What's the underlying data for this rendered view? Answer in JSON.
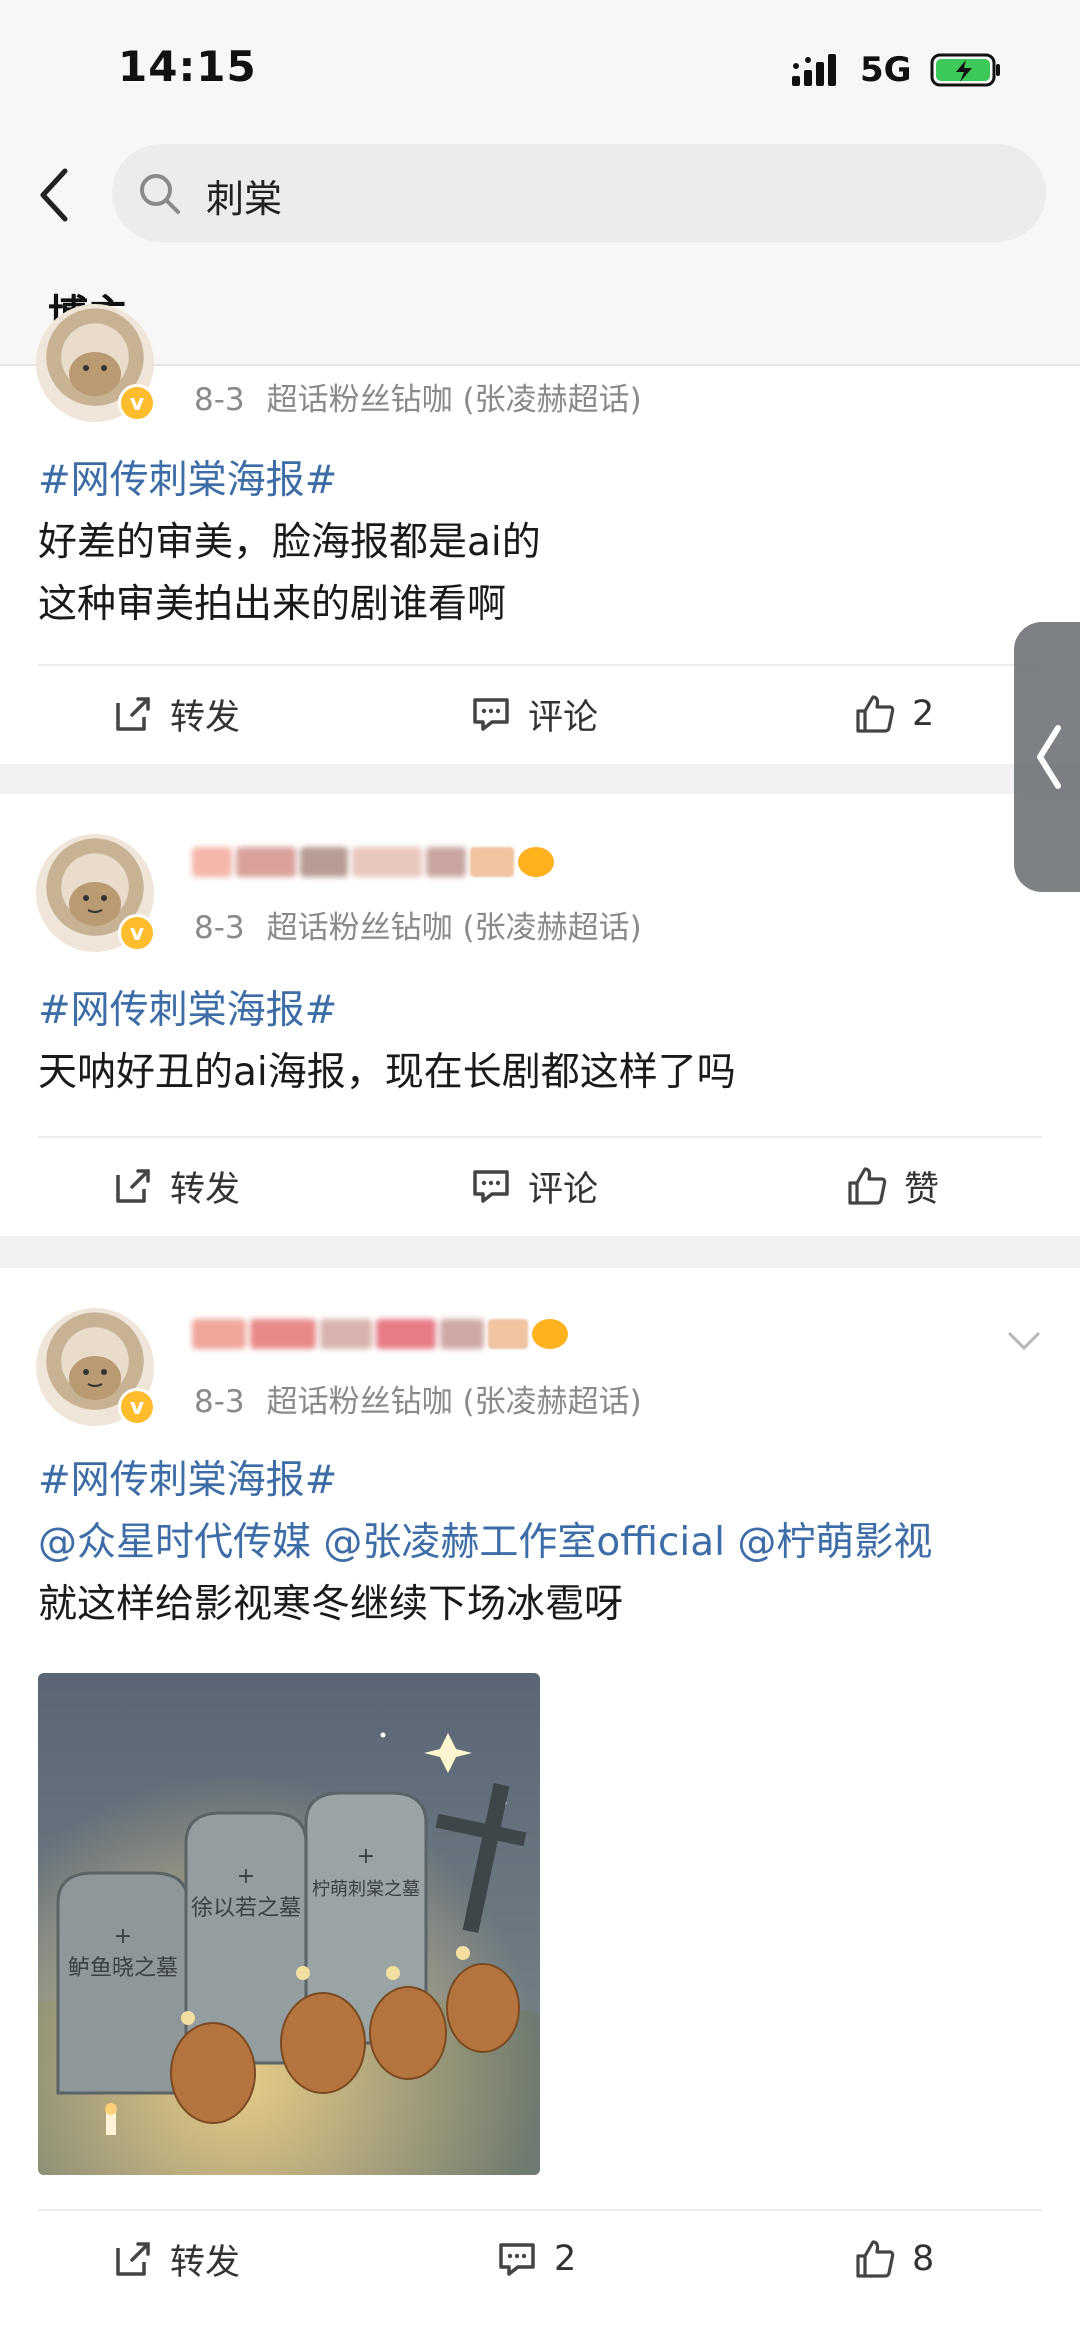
{
  "status_bar": {
    "time": "14:15",
    "network": "5G"
  },
  "search": {
    "query": "刺棠"
  },
  "tabs": [
    {
      "label": "博主",
      "active": true
    }
  ],
  "posts": [
    {
      "date": "8-3",
      "source": "超话粉丝钻咖 (张凌赫超话)",
      "topic": "#网传刺棠海报#",
      "lines": [
        "好差的审美，脸海报都是ai的",
        "这种审美拍出来的剧谁看啊"
      ],
      "actions": {
        "repost": "转发",
        "comment": "评论",
        "like": "2"
      }
    },
    {
      "date": "8-3",
      "source": "超话粉丝钻咖 (张凌赫超话)",
      "topic": "#网传刺棠海报#",
      "lines": [
        "天呐好丑的ai海报，现在长剧都这样了吗"
      ],
      "actions": {
        "repost": "转发",
        "comment": "评论",
        "like": "赞"
      }
    },
    {
      "date": "8-3",
      "source": "超话粉丝钻咖 (张凌赫超话)",
      "topic": "#网传刺棠海报#",
      "mentions": [
        "@众星时代传媒",
        "@张凌赫工作室official",
        "@柠萌影视"
      ],
      "lines": [
        "就这样给影视寒冬继续下场冰雹呀"
      ],
      "image": {
        "tombstones": [
          "鲈鱼晓之墓",
          "徐以若之墓",
          "柠萌刺棠之墓"
        ]
      },
      "actions": {
        "repost": "转发",
        "comment": "2",
        "like": "8"
      }
    }
  ],
  "colors": {
    "accent": "#ff8200",
    "link": "#3d6da6",
    "meta": "#8a8a8a",
    "verified": "#ffbd2e"
  },
  "icons": [
    "back-arrow-icon",
    "search-icon",
    "repost-icon",
    "comment-icon",
    "like-icon",
    "chevron-down-icon",
    "signal-icon",
    "battery-charging-icon"
  ]
}
